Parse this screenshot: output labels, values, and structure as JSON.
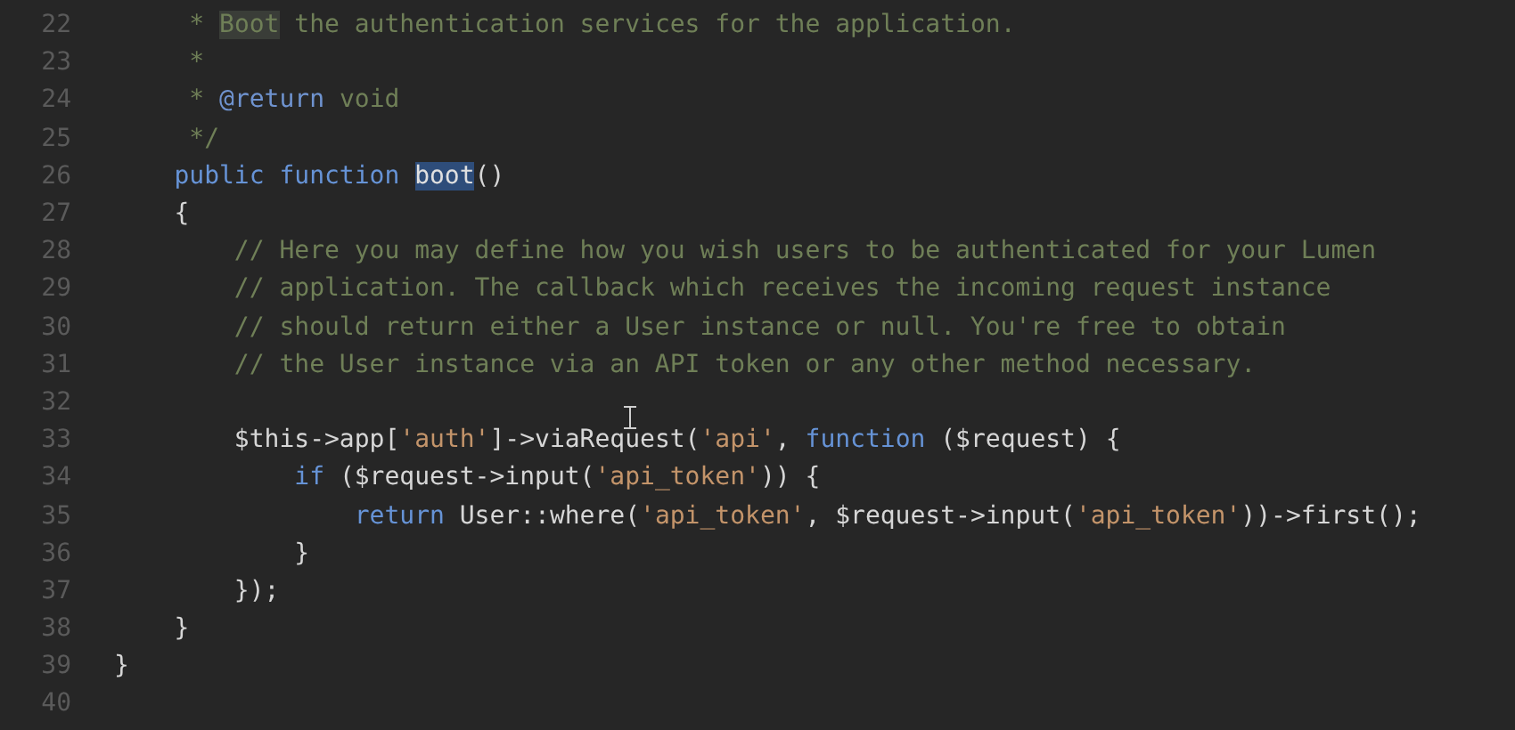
{
  "editor": {
    "lines": [
      {
        "number": "22",
        "tokens": [
          {
            "text": "     * ",
            "kind": "comment"
          },
          {
            "text": "Boot",
            "kind": "comment-match"
          },
          {
            "text": " the authentication services for the application.",
            "kind": "comment"
          }
        ]
      },
      {
        "number": "23",
        "tokens": [
          {
            "text": "     *",
            "kind": "comment"
          }
        ]
      },
      {
        "number": "24",
        "tokens": [
          {
            "text": "     * ",
            "kind": "comment"
          },
          {
            "text": "@return",
            "kind": "doc-tag"
          },
          {
            "text": " void",
            "kind": "comment"
          }
        ]
      },
      {
        "number": "25",
        "tokens": [
          {
            "text": "     */",
            "kind": "comment"
          }
        ]
      },
      {
        "number": "26",
        "tokens": [
          {
            "text": "    public function ",
            "kind": "keyword"
          },
          {
            "text": "boot",
            "kind": "selection"
          },
          {
            "text": "()",
            "kind": "plain"
          }
        ]
      },
      {
        "number": "27",
        "tokens": [
          {
            "text": "    {",
            "kind": "plain"
          }
        ]
      },
      {
        "number": "28",
        "tokens": [
          {
            "text": "        // Here you may define how you wish users to be authenticated for your Lumen",
            "kind": "comment"
          }
        ]
      },
      {
        "number": "29",
        "tokens": [
          {
            "text": "        // application. The callback which receives the incoming request instance",
            "kind": "comment"
          }
        ]
      },
      {
        "number": "30",
        "tokens": [
          {
            "text": "        // should return either a User instance or null. You're free to obtain",
            "kind": "comment"
          }
        ]
      },
      {
        "number": "31",
        "tokens": [
          {
            "text": "        // the User instance via an API token or any other method necessary.",
            "kind": "comment"
          }
        ]
      },
      {
        "number": "32"
      },
      {
        "number": "33",
        "tokens": [
          {
            "text": "        $this->app[",
            "kind": "plain"
          },
          {
            "text": "'auth'",
            "kind": "string"
          },
          {
            "text": "]->viaRequest(",
            "kind": "plain"
          },
          {
            "text": "'api'",
            "kind": "string"
          },
          {
            "text": ", ",
            "kind": "plain"
          },
          {
            "text": "function",
            "kind": "keyword"
          },
          {
            "text": " ($request) {",
            "kind": "plain"
          }
        ]
      },
      {
        "number": "34",
        "tokens": [
          {
            "text": "            if",
            "kind": "keyword"
          },
          {
            "text": " ($request->input(",
            "kind": "plain"
          },
          {
            "text": "'api_token'",
            "kind": "string"
          },
          {
            "text": ")) {",
            "kind": "plain"
          }
        ]
      },
      {
        "number": "35",
        "tokens": [
          {
            "text": "                return",
            "kind": "keyword"
          },
          {
            "text": " User::where(",
            "kind": "plain"
          },
          {
            "text": "'api_token'",
            "kind": "string"
          },
          {
            "text": ", $request->input(",
            "kind": "plain"
          },
          {
            "text": "'api_token'",
            "kind": "string"
          },
          {
            "text": "))->first();",
            "kind": "plain"
          }
        ]
      },
      {
        "number": "36",
        "tokens": [
          {
            "text": "            }",
            "kind": "plain"
          }
        ]
      },
      {
        "number": "37",
        "tokens": [
          {
            "text": "        });",
            "kind": "plain"
          }
        ]
      },
      {
        "number": "38",
        "tokens": [
          {
            "text": "    }",
            "kind": "plain"
          }
        ]
      },
      {
        "number": "39",
        "tokens": [
          {
            "text": "}",
            "kind": "plain"
          }
        ]
      },
      {
        "number": "40"
      }
    ]
  }
}
